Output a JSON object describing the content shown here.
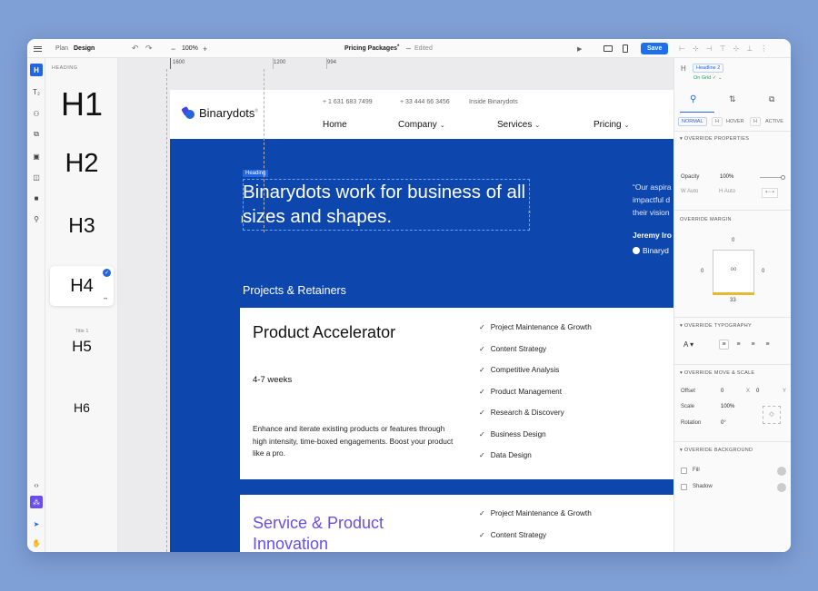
{
  "topbar": {
    "modes": [
      "Plan",
      "Design"
    ],
    "zoom": "100%",
    "doc_title": "Pricing Packages",
    "doc_status": "Edited",
    "save_label": "Save"
  },
  "headings_panel": {
    "title": "HEADING",
    "items": [
      "H1",
      "H2",
      "H3",
      "H4",
      "H5",
      "H6"
    ],
    "selected_caption": "Title 1"
  },
  "ruler": {
    "marks": [
      "1600",
      "1200",
      "994"
    ]
  },
  "site": {
    "brand": "Binarydots",
    "phone1": "+ 1 631 683 7499",
    "phone2": "+ 33 444 66 3456",
    "inside": "Inside Binarydots",
    "nav": [
      "Home",
      "Company",
      "Services",
      "Pricing"
    ],
    "heading_tag": "Heading",
    "hero_title": "Binarydots work for business of all sizes and shapes.",
    "quote_lines": [
      "“Our aspira",
      "impactful d",
      "their vision"
    ],
    "quote_name": "Jeremy Iro",
    "quote_company": "Binaryd",
    "section_label": "Projects & Retainers",
    "cards": [
      {
        "title": "Product Accelerator",
        "duration": "4-7 weeks",
        "description": "Enhance and iterate existing products or features through high intensity, time-boxed engagements. Boost your product like a pro.",
        "features": [
          "Project Maintenance & Growth",
          "Content Strategy",
          "Competitive Analysis",
          "Product Management",
          "Research & Discovery",
          "Business Design",
          "Data Design"
        ]
      },
      {
        "title": "Service & Product Innovation",
        "features": [
          "Project Maintenance & Growth",
          "Content Strategy"
        ]
      }
    ]
  },
  "props": {
    "element_name": "Headline 2",
    "on_grid": "On Grid",
    "states": [
      "NORMAL",
      "HOVER",
      "ACTIVE"
    ],
    "override_properties": "OVERRIDE PROPERTIES",
    "opacity_label": "Opacity",
    "opacity_value": "100%",
    "w_label": "W",
    "w_value": "Auto",
    "h_label": "H",
    "h_value": "Auto",
    "override_margin": "OVERRIDE MARGIN",
    "margin_top": "0",
    "margin_left": "0",
    "margin_right": "0",
    "margin_bottom": "33",
    "margin_center": "oo",
    "override_typography": "OVERRIDE TYPOGRAPHY",
    "override_move": "OVERRIDE MOVE & SCALE",
    "offset_label": "Offset",
    "offset_x": "0",
    "offset_x_axis": "X",
    "offset_y": "0",
    "offset_y_axis": "Y",
    "scale_label": "Scale",
    "scale_value": "100%",
    "rotation_label": "Rotation",
    "rotation_value": "0°",
    "override_background": "OVERRIDE BACKGROUND",
    "fill_label": "Fill",
    "shadow_label": "Shadow"
  },
  "colors": {
    "accent": "#2466e0",
    "page_blue": "#0d47ae",
    "purple": "#6a4ee8",
    "save": "#1f6fea"
  }
}
